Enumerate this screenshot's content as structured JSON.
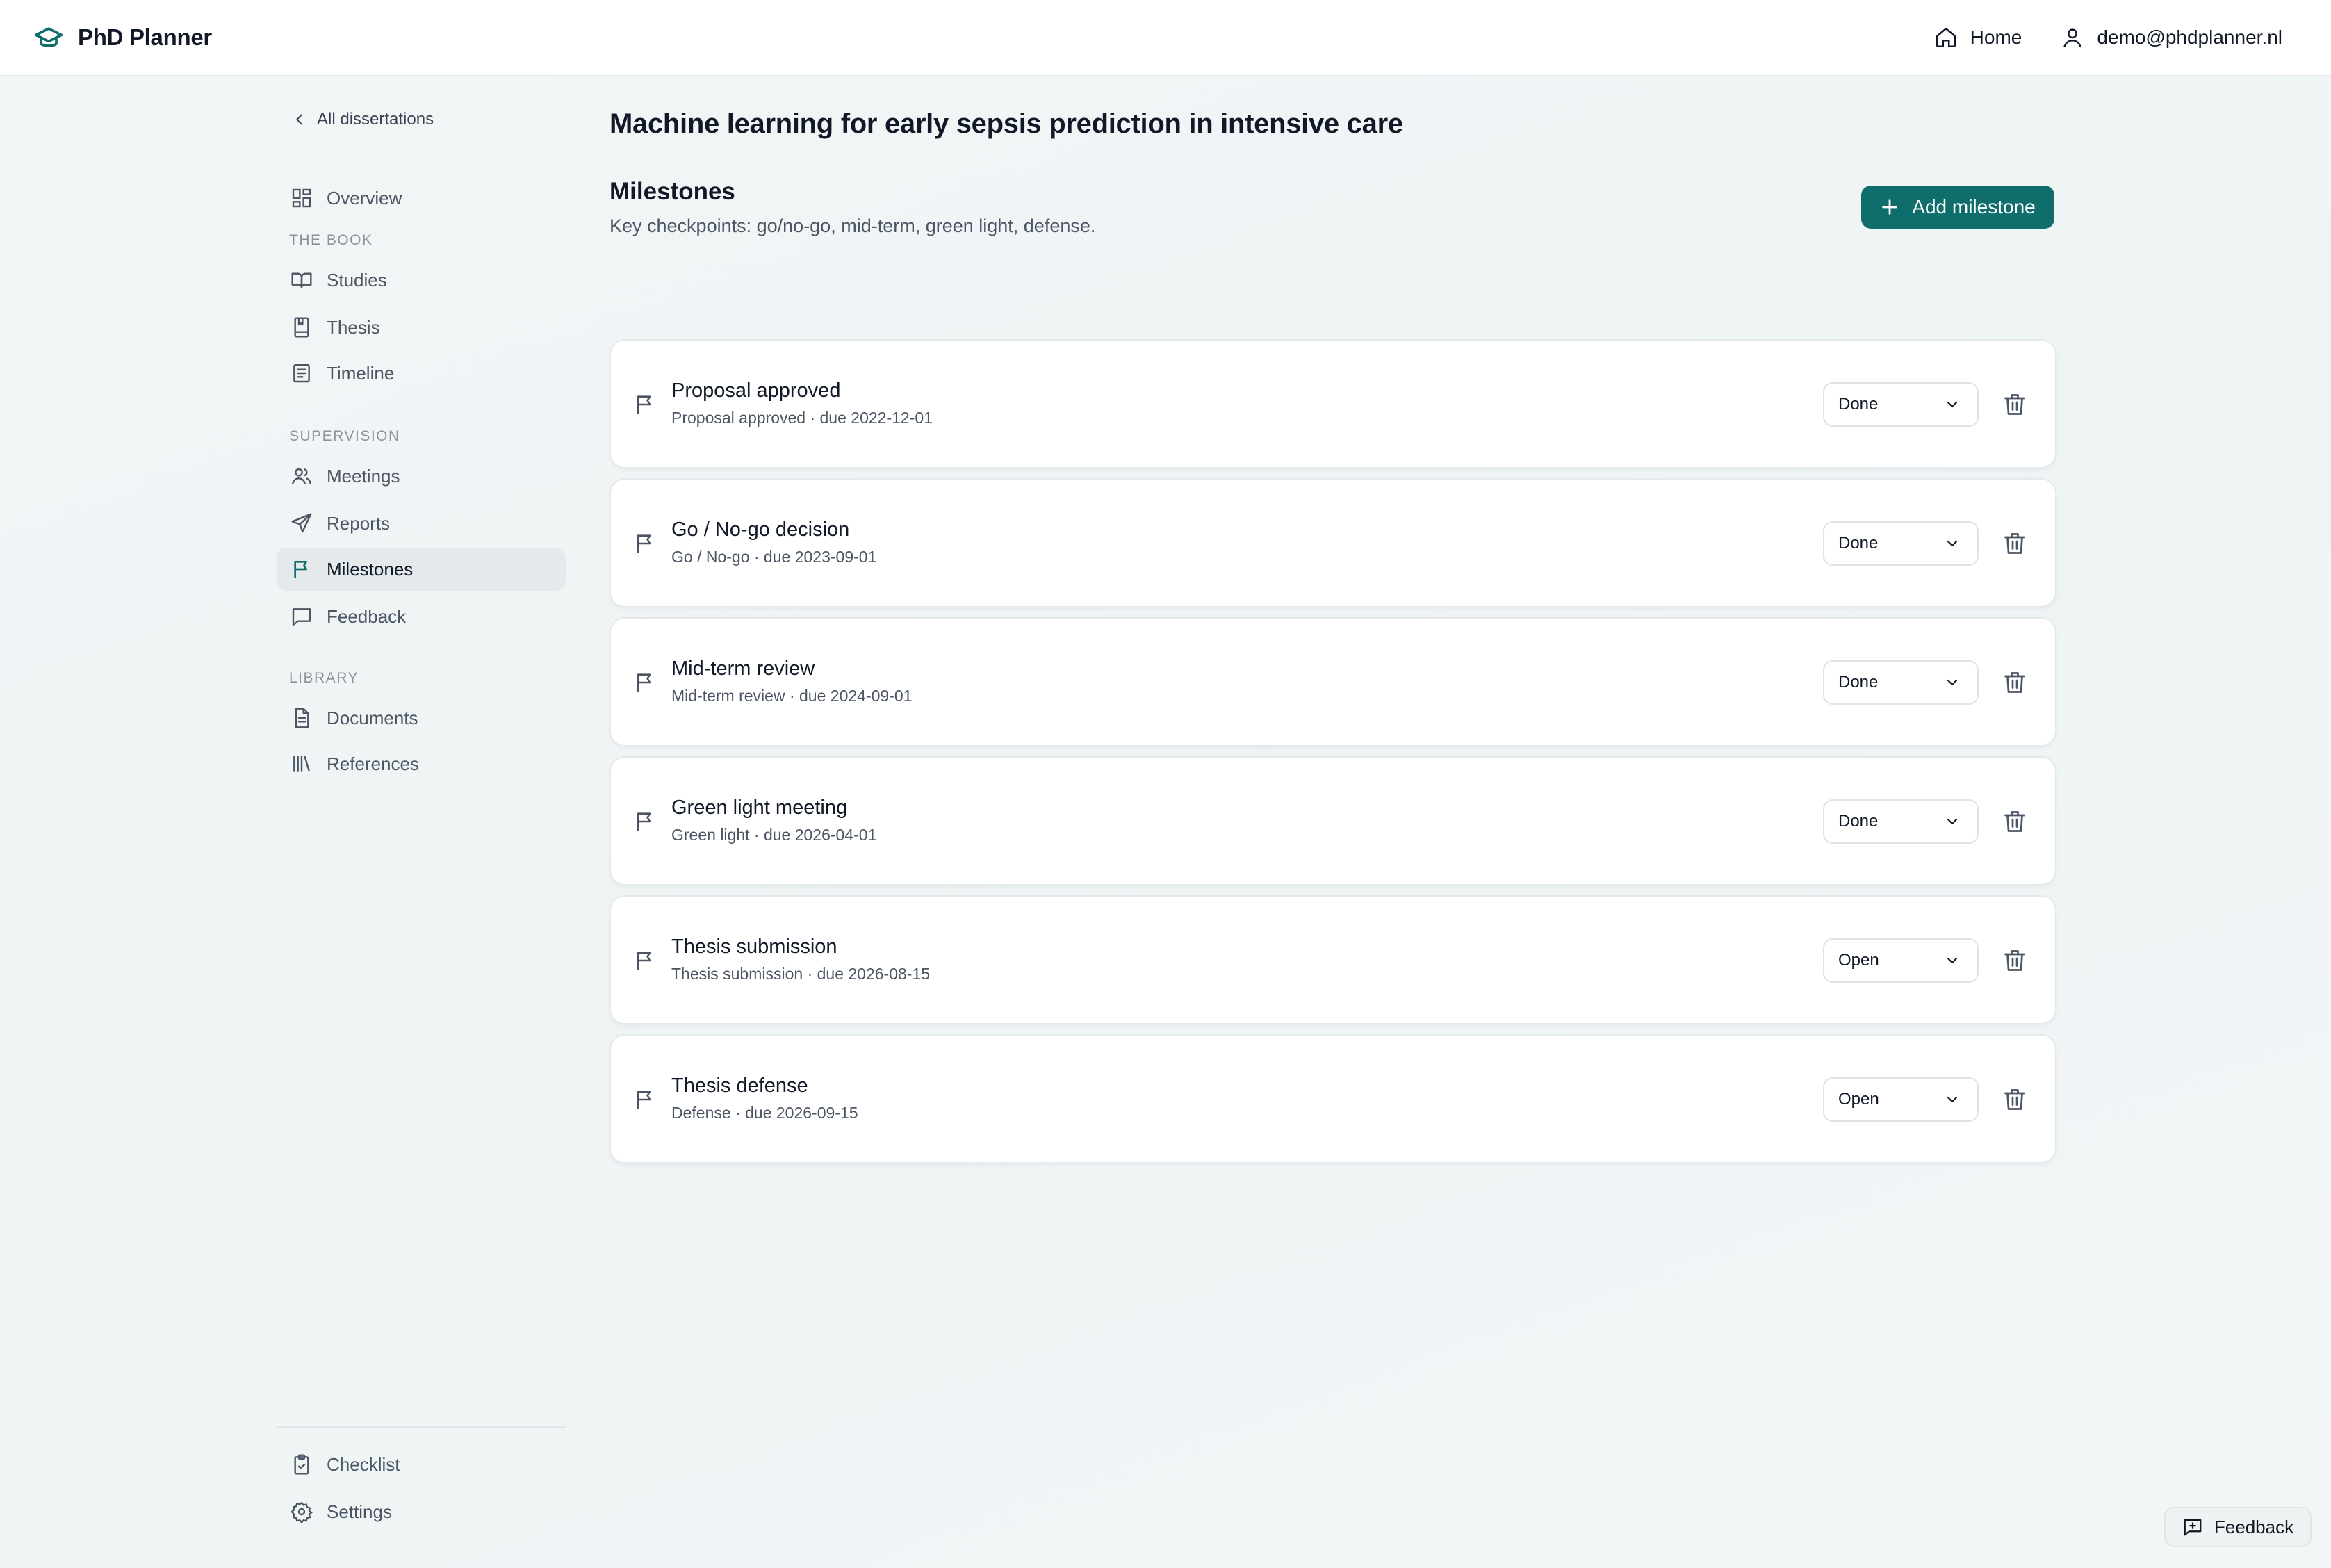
{
  "app": {
    "name": "PhD Planner",
    "accent": "#0f6e6b"
  },
  "topnav": {
    "home_label": "Home",
    "user_email": "demo@phdplanner.nl"
  },
  "sidebar": {
    "back_label": "All dissertations",
    "overview_label": "Overview",
    "section_book": "THE BOOK",
    "book_items": [
      "Studies",
      "Thesis",
      "Timeline"
    ],
    "section_supervision": "SUPERVISION",
    "supervision_items": [
      "Meetings",
      "Reports",
      "Milestones",
      "Feedback"
    ],
    "section_library": "LIBRARY",
    "library_items": [
      "Documents",
      "References"
    ],
    "footer_items": [
      "Checklist",
      "Settings"
    ],
    "active_item": "Milestones"
  },
  "main": {
    "page_title": "Machine learning for early sepsis prediction in intensive care",
    "section_title": "Milestones",
    "section_subtitle": "Key checkpoints: go/no-go, mid-term, green light, defense.",
    "add_button_label": "Add milestone"
  },
  "milestones": [
    {
      "title": "Proposal approved",
      "meta": "Proposal approved · due 2022-12-01",
      "status": "Done"
    },
    {
      "title": "Go / No-go decision",
      "meta": "Go / No-go · due 2023-09-01",
      "status": "Done"
    },
    {
      "title": "Mid-term review",
      "meta": "Mid-term review · due 2024-09-01",
      "status": "Done"
    },
    {
      "title": "Green light meeting",
      "meta": "Green light · due 2026-04-01",
      "status": "Done"
    },
    {
      "title": "Thesis submission",
      "meta": "Thesis submission · due 2026-08-15",
      "status": "Open"
    },
    {
      "title": "Thesis defense",
      "meta": "Defense · due 2026-09-15",
      "status": "Open"
    }
  ],
  "feedback_button_label": "Feedback"
}
